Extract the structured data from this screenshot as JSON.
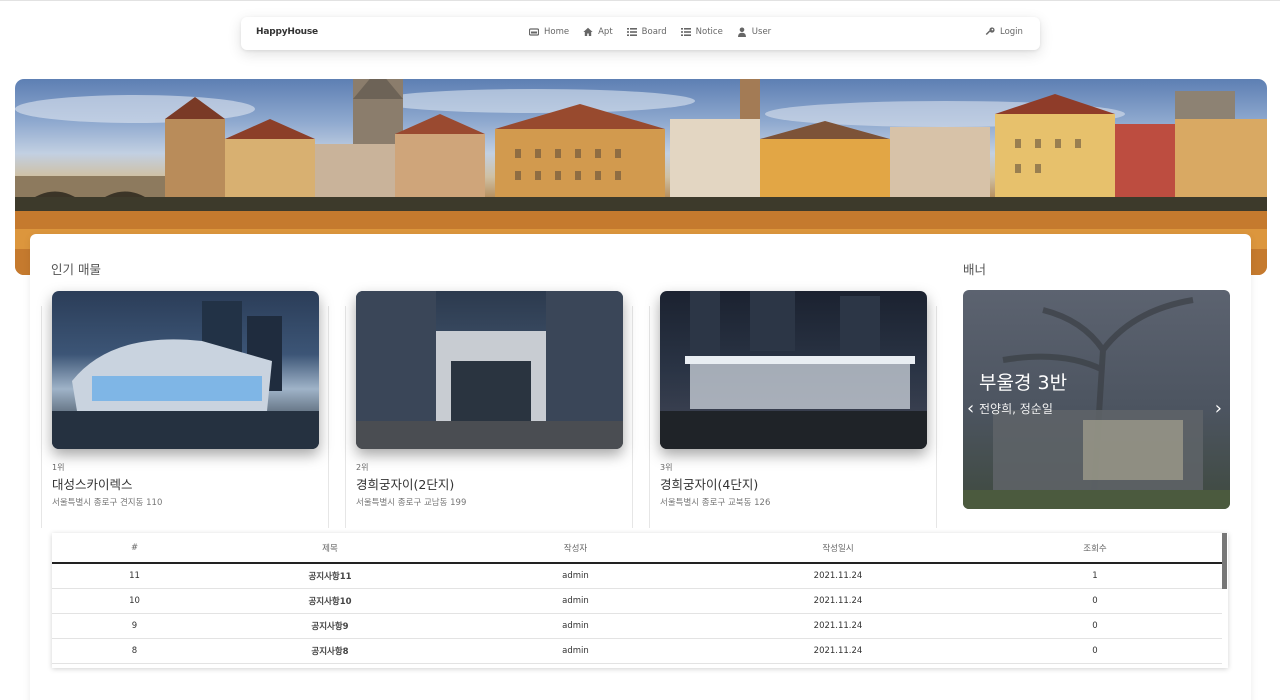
{
  "nav": {
    "brand": "HappyHouse",
    "items": [
      {
        "label": "Home",
        "icon": "home-icon"
      },
      {
        "label": "Apt",
        "icon": "house-icon"
      },
      {
        "label": "Board",
        "icon": "list-icon"
      },
      {
        "label": "Notice",
        "icon": "list-icon"
      },
      {
        "label": "User",
        "icon": "user-icon"
      }
    ],
    "login": "Login"
  },
  "popular": {
    "title": "인기 매물",
    "items": [
      {
        "rank": "1위",
        "name": "대성스카이렉스",
        "address": "서울특별시 종로구 견지동 110"
      },
      {
        "rank": "2위",
        "name": "경희궁자이(2단지)",
        "address": "서울특별시 종로구 교남동 199"
      },
      {
        "rank": "3위",
        "name": "경희궁자이(4단지)",
        "address": "서울특별시 종로구 교북동 126"
      }
    ]
  },
  "banner": {
    "title": "배너",
    "slide_title": "부울경 3반",
    "slide_subtitle": "전양희, 정순일"
  },
  "notice_table": {
    "columns": [
      "#",
      "제목",
      "작성자",
      "작성일시",
      "조회수"
    ],
    "rows": [
      [
        "11",
        "공지사항11",
        "admin",
        "2021.11.24",
        "1"
      ],
      [
        "10",
        "공지사항10",
        "admin",
        "2021.11.24",
        "0"
      ],
      [
        "9",
        "공지사항9",
        "admin",
        "2021.11.24",
        "0"
      ],
      [
        "8",
        "공지사항8",
        "admin",
        "2021.11.24",
        "0"
      ]
    ]
  }
}
